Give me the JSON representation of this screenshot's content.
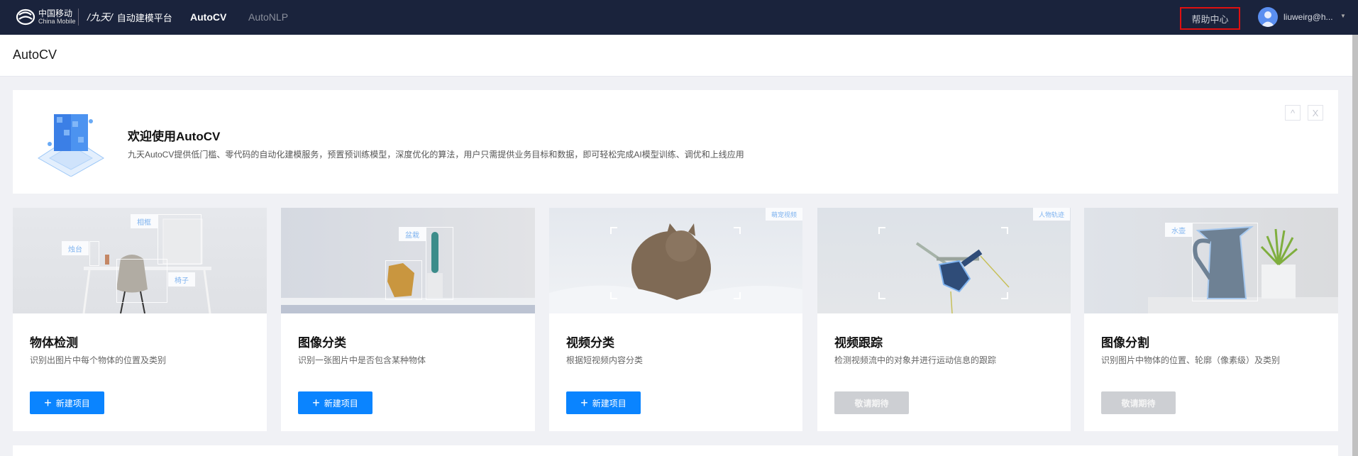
{
  "topnav": {
    "logo_cn": "中国移动",
    "logo_en": "China Mobile",
    "platform": "自动建模平台",
    "nav": [
      {
        "label": "AutoCV",
        "active": true
      },
      {
        "label": "AutoNLP",
        "active": false
      }
    ],
    "help": "帮助中心",
    "user": "liuweirg@h..."
  },
  "page": {
    "title": "AutoCV"
  },
  "welcome": {
    "title": "欢迎使用AutoCV",
    "desc": "九天AutoCV提供低门槛、零代码的自动化建模服务，预置预训练模型，深度优化的算法，用户只需提供业务目标和数据，即可轻松完成AI模型训练、调优和上线应用",
    "collapse": "^",
    "close": "X"
  },
  "cards": [
    {
      "title": "物体检测",
      "desc": "识别出图片中每个物体的位置及类别",
      "button": "新建项目",
      "enabled": true,
      "tags": [
        "相框",
        "烛台",
        "椅子"
      ]
    },
    {
      "title": "图像分类",
      "desc": "识别一张图片中是否包含某种物体",
      "button": "新建项目",
      "enabled": true,
      "tags": [
        "盆栽"
      ]
    },
    {
      "title": "视频分类",
      "desc": "根据短视频内容分类",
      "button": "新建项目",
      "enabled": true,
      "tags": [
        "萌宠视频"
      ]
    },
    {
      "title": "视频跟踪",
      "desc": "检测视频流中的对象并进行运动信息的跟踪",
      "button": "敬请期待",
      "enabled": false,
      "tags": [
        "人物轨迹"
      ]
    },
    {
      "title": "图像分割",
      "desc": "识别图片中物体的位置、轮廓（像素级）及类别",
      "button": "敬请期待",
      "enabled": false,
      "tags": [
        "水壶"
      ]
    }
  ],
  "colors": {
    "nav_bg": "#1a233c",
    "primary": "#0a84ff",
    "disabled": "#cdcfd3",
    "highlight": "#e01010"
  }
}
